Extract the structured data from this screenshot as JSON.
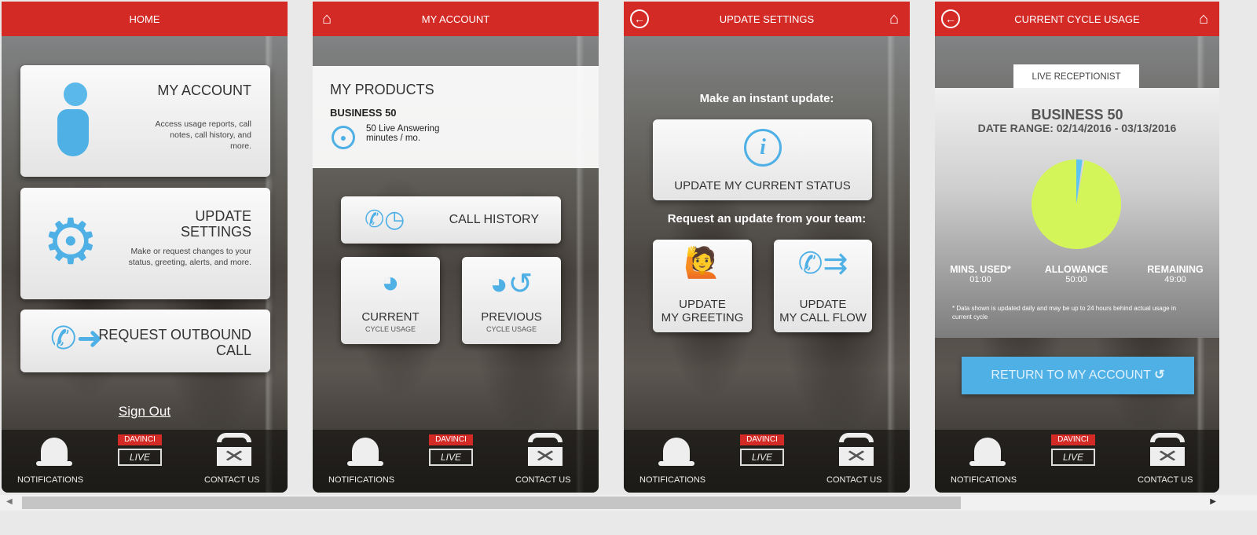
{
  "screens": {
    "home": {
      "title": "HOME",
      "cards": [
        {
          "title": "MY ACCOUNT",
          "desc": "Access usage reports, call notes, call history, and more.",
          "icon": "person-icon"
        },
        {
          "title": "UPDATE SETTINGS",
          "desc": "Make or request changes to your status, greeting, alerts, and more.",
          "icon": "gear-icon"
        },
        {
          "title": "REQUEST OUTBOUND CALL",
          "icon": "phone-arrow-icon"
        }
      ],
      "sign_out": "Sign Out"
    },
    "account": {
      "title": "MY ACCOUNT",
      "products_heading": "MY PRODUCTS",
      "plan": "BUSINESS 50",
      "plan_detail": "50 Live Answering minutes / mo.",
      "call_history": "CALL HISTORY",
      "current": {
        "label": "CURRENT",
        "sub": "CYCLE USAGE"
      },
      "previous": {
        "label": "PREVIOUS",
        "sub": "CYCLE USAGE"
      }
    },
    "settings": {
      "title": "UPDATE SETTINGS",
      "instant_heading": "Make an instant update:",
      "status_button": "UPDATE MY CURRENT STATUS",
      "request_heading": "Request an update from your team:",
      "greeting": {
        "line1": "UPDATE",
        "line2": "MY GREETING"
      },
      "callflow": {
        "line1": "UPDATE",
        "line2": "MY CALL FLOW"
      }
    },
    "usage": {
      "title": "CURRENT CYCLE USAGE",
      "tab": "LIVE RECEPTIONIST",
      "plan": "BUSINESS 50",
      "date_range": "DATE RANGE: 02/14/2016 - 03/13/2016",
      "stats": [
        {
          "label": "MINS. USED*",
          "value": "01:00"
        },
        {
          "label": "ALLOWANCE",
          "value": "50:00"
        },
        {
          "label": "REMAINING",
          "value": "49:00"
        }
      ],
      "footnote": "* Data shown is updated daily and may be up to 24 hours behind actual usage in current cycle",
      "return_button": "RETURN TO MY ACCOUNT",
      "pie": {
        "used_fraction": 0.02,
        "used_color": "#5bc4f0",
        "remaining_color": "#d4f55a"
      }
    }
  },
  "nav": {
    "notifications": "NOTIFICATIONS",
    "davinci": "DAVINCI",
    "live": "LIVE",
    "contact": "CONTACT US"
  },
  "colors": {
    "header": "#d42a26",
    "accent": "#4fb0e6"
  }
}
